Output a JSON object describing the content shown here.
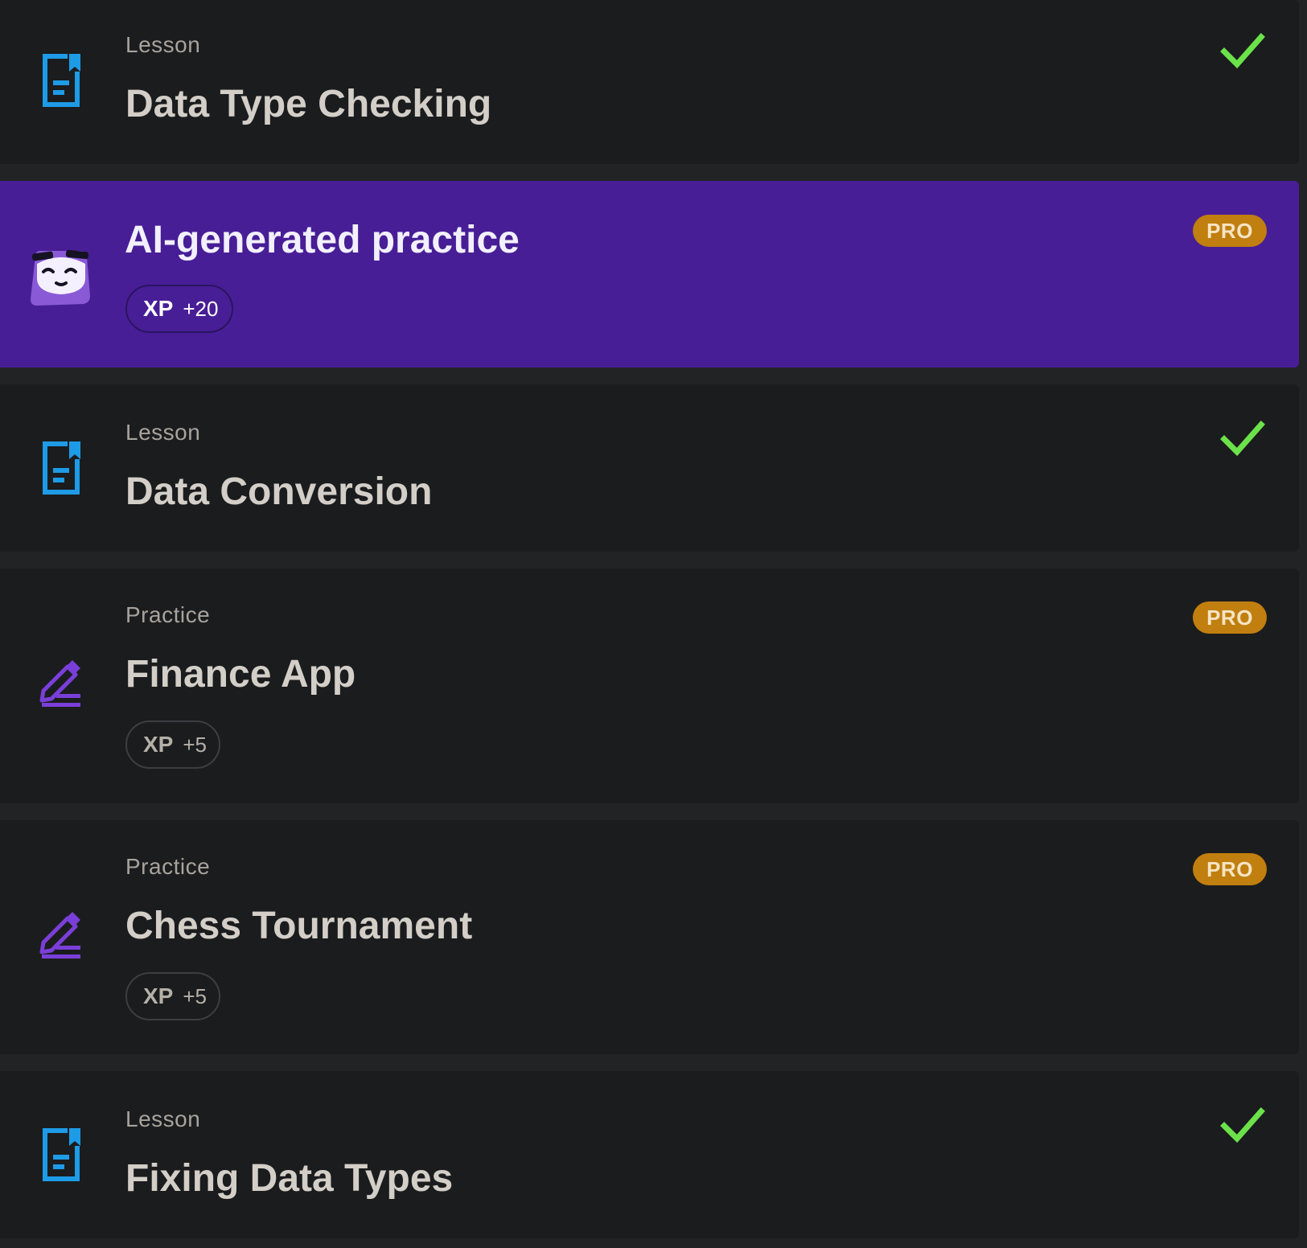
{
  "colors": {
    "page_bg": "#222325",
    "card_bg": "#1b1c1e",
    "ai_card_bg": "#481e96",
    "lesson_icon": "#1e9be6",
    "practice_icon": "#7a3fd8",
    "check": "#6be24a",
    "pro_badge": "#c07f0e"
  },
  "items": [
    {
      "type": "lesson",
      "icon": "lesson-document-icon",
      "kind_label": "Lesson",
      "title": "Data Type Checking",
      "completed": true
    },
    {
      "type": "ai-practice",
      "icon": "ai-mascot-icon",
      "title": "AI-generated practice",
      "badge": "PRO",
      "xp_label": "XP",
      "xp_value": "+20"
    },
    {
      "type": "lesson",
      "icon": "lesson-document-icon",
      "kind_label": "Lesson",
      "title": "Data Conversion",
      "completed": true
    },
    {
      "type": "practice",
      "icon": "practice-pencil-icon",
      "kind_label": "Practice",
      "title": "Finance App",
      "badge": "PRO",
      "xp_label": "XP",
      "xp_value": "+5"
    },
    {
      "type": "practice",
      "icon": "practice-pencil-icon",
      "kind_label": "Practice",
      "title": "Chess Tournament",
      "badge": "PRO",
      "xp_label": "XP",
      "xp_value": "+5"
    },
    {
      "type": "lesson",
      "icon": "lesson-document-icon",
      "kind_label": "Lesson",
      "title": "Fixing Data Types",
      "completed": true
    }
  ]
}
